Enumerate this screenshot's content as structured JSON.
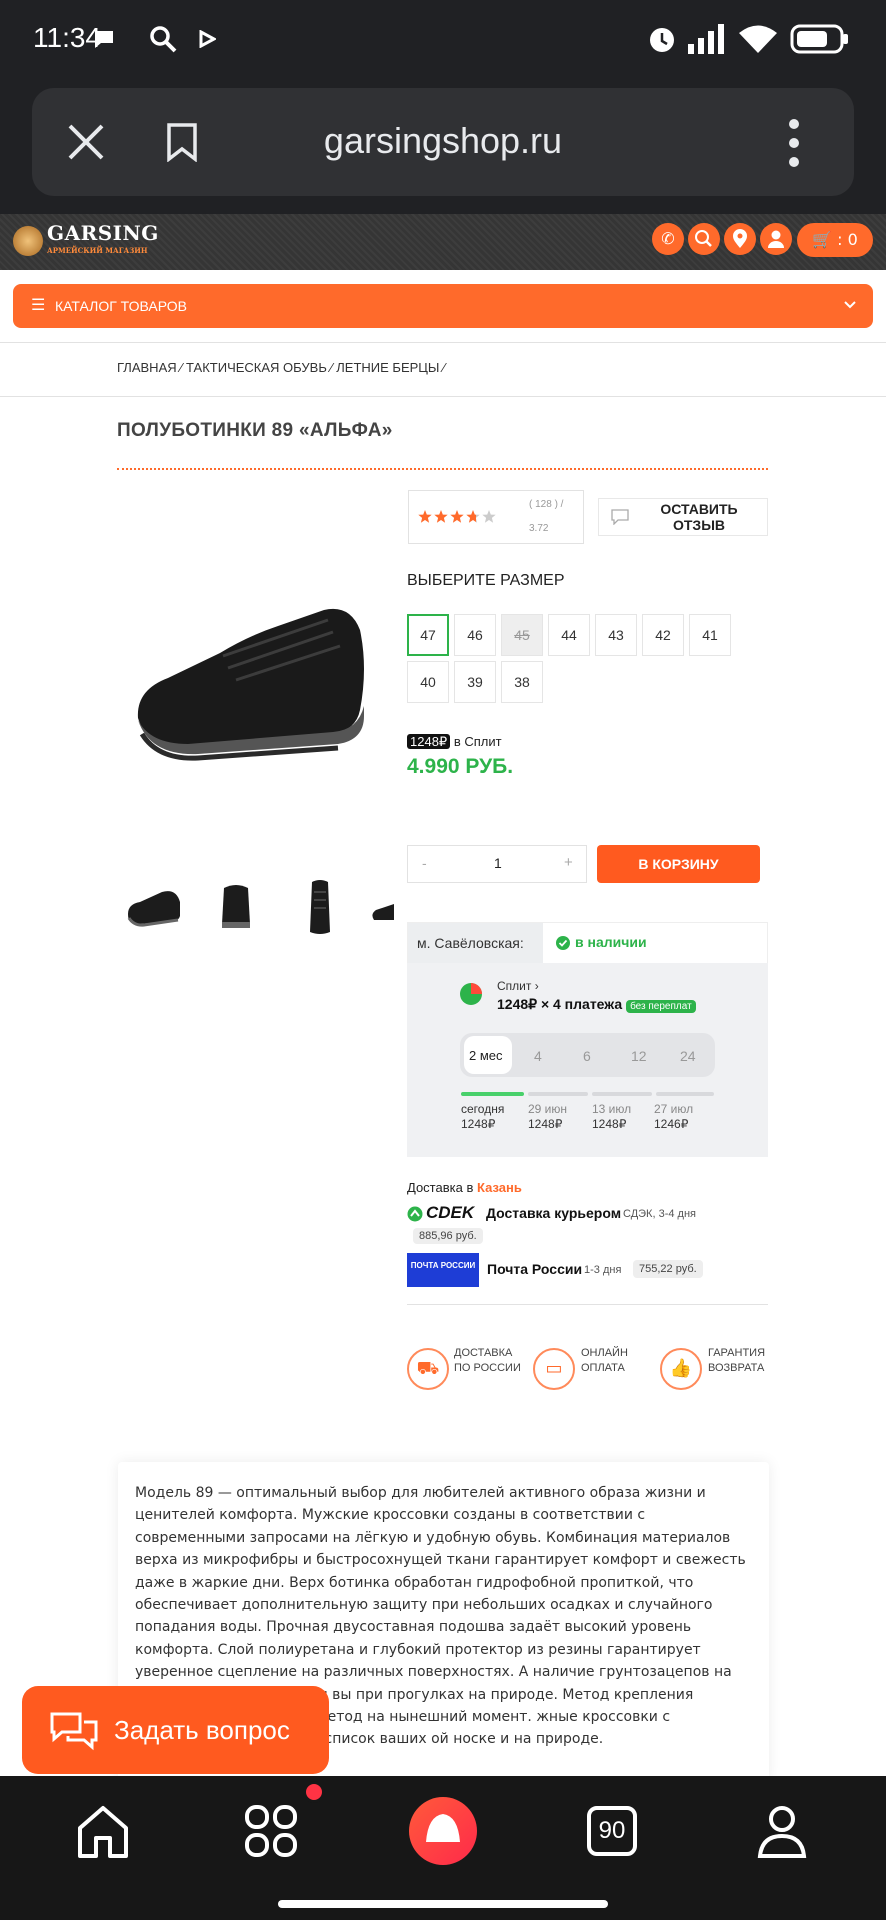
{
  "status_bar": {
    "time": "11:34"
  },
  "browser": {
    "url": "garsingshop.ru"
  },
  "site": {
    "logo_title": "GARSING",
    "logo_subtitle": "АРМЕЙСКИЙ МАГАЗИН",
    "cart_count": "0",
    "catalog_label": "КАТАЛОГ ТОВАРОВ"
  },
  "breadcrumbs": [
    "ГЛАВНАЯ",
    "ТАКТИЧЕСКАЯ ОБУВЬ",
    "ЛЕТНИЕ БЕРЦЫ"
  ],
  "product": {
    "title": "ПОЛУБОТИНКИ 89 «АЛЬФА»",
    "rating": 3.72,
    "rating_count": "( 128 ) /",
    "rating_value": "3.72",
    "review_button": "ОСТАВИТЬ ОТЗЫВ",
    "size_heading": "ВЫБЕРИТЕ РАЗМЕР",
    "sizes": [
      "47",
      "46",
      "45",
      "44",
      "43",
      "42",
      "41",
      "40",
      "39",
      "38"
    ],
    "selected_size": "47",
    "unavailable_size": "45",
    "split_badge": "1248₽",
    "split_text": "в Сплит",
    "price": "4.990 РУБ.",
    "qty_minus": "-",
    "qty_value": "1",
    "qty_plus": "+",
    "add_to_cart": "В КОРЗИНУ"
  },
  "availability": {
    "store": "м. Савёловская:",
    "status": "в наличии"
  },
  "split": {
    "title": "Сплит",
    "payments": "1248₽ × 4 платежа",
    "badge": "без переплат",
    "periods": [
      "2 мес",
      "4",
      "6",
      "12",
      "24"
    ],
    "schedule": [
      {
        "date": "сегодня",
        "amount": "1248₽"
      },
      {
        "date": "29 июн",
        "amount": "1248₽"
      },
      {
        "date": "13 июл",
        "amount": "1248₽"
      },
      {
        "date": "27 июл",
        "amount": "1246₽"
      }
    ]
  },
  "delivery": {
    "label": "Доставка в",
    "city": "Казань",
    "cdek_name": "CDEK",
    "cdek_title": "Доставка курьером",
    "cdek_terms": "СДЭК, 3-4 дня",
    "cdek_price": "885,96 руб.",
    "post_logo": "ПОЧТА РОССИИ",
    "post_title": "Почта России",
    "post_terms": "1-3 дня",
    "post_price": "755,22 руб."
  },
  "features": [
    {
      "icon": "truck-icon",
      "line1": "ДОСТАВКА",
      "line2": "ПО РОССИИ"
    },
    {
      "icon": "card-icon",
      "line1": "ОНЛАЙН",
      "line2": "ОПЛАТА"
    },
    {
      "icon": "thumbs-up-icon",
      "line1": "ГАРАНТИЯ",
      "line2": "ВОЗВРАТА"
    }
  ],
  "description": "Модель 89 — оптимальный выбор для любителей активного образа жизни и ценителей комфорта. Мужские кроссовки созданы в соответствии с современными запросами на лёгкую и удобную обувь. Комбинация материалов верха из микрофибры и быстросохнущей ткани гарантирует комфорт и свежесть даже в жаркие дни. Верх ботинка обработан гидрофобной пропиткой, что обеспечивает дополнительную защиту при небольших осадках и случайного попадания воды. Прочная двусоставная подошва задаёт высокий уровень комфорта. Слой полиуретана и глубокий протектор из резины гарантирует уверенное сцепление на различных поверхностях. А наличие грунтозацепов на носочке и пятке подошвы вы при прогулках на природе. Метод крепления подошвы й и надежный метод на нынешний момент. жные кроссовки с лёгкостью удовлетворят список ваших ой носке и на природе.",
  "ask_button": "Задать вопрос",
  "nav": {
    "badge_90": "90"
  },
  "colors": {
    "accent": "#ff6a2b",
    "price_green": "#2db34a",
    "dark": "#202124"
  }
}
